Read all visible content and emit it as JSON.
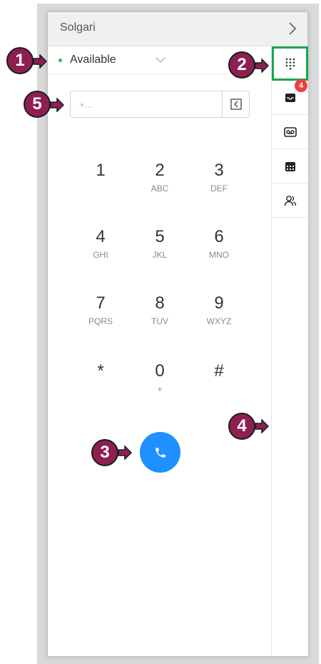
{
  "header": {
    "title": "Solgari"
  },
  "status": {
    "label": "Available",
    "dot_color": "#3bb54a"
  },
  "dial_input": {
    "placeholder": "+...",
    "value": ""
  },
  "keypad": [
    {
      "digit": "1",
      "letters": ""
    },
    {
      "digit": "2",
      "letters": "ABC"
    },
    {
      "digit": "3",
      "letters": "DEF"
    },
    {
      "digit": "4",
      "letters": "GHI"
    },
    {
      "digit": "5",
      "letters": "JKL"
    },
    {
      "digit": "6",
      "letters": "MNO"
    },
    {
      "digit": "7",
      "letters": "PQRS"
    },
    {
      "digit": "8",
      "letters": "TUV"
    },
    {
      "digit": "9",
      "letters": "WXYZ"
    },
    {
      "digit": "*",
      "letters": ""
    },
    {
      "digit": "0",
      "letters": "+"
    },
    {
      "digit": "#",
      "letters": ""
    }
  ],
  "rail": {
    "items": [
      {
        "icon": "dialpad-icon",
        "active": true
      },
      {
        "icon": "inbox-icon",
        "badge": "4"
      },
      {
        "icon": "voicemail-icon"
      },
      {
        "icon": "calendar-icon"
      },
      {
        "icon": "contacts-icon"
      }
    ]
  },
  "call_button": {
    "icon": "phone-icon",
    "color": "#1e90ff"
  },
  "callouts": [
    "1",
    "2",
    "3",
    "4",
    "5"
  ],
  "colors": {
    "callout": "#8e1f52",
    "active_outline": "#1aa84a",
    "badge": "#ee4040"
  }
}
